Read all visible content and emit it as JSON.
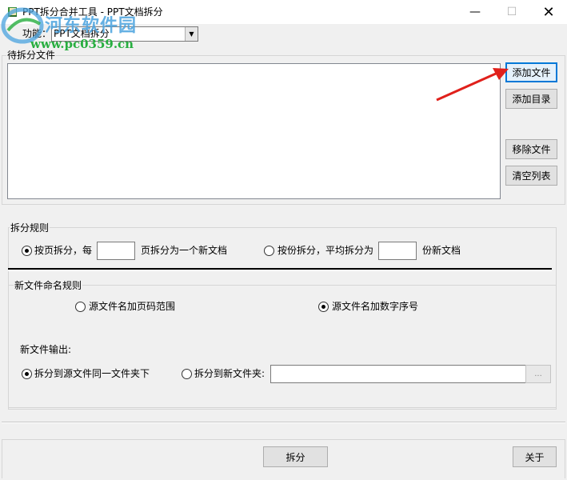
{
  "window": {
    "title": "PPT拆分合并工具 - PPT文档拆分",
    "minimize_glyph": "—",
    "maximize_glyph": "☐",
    "close_glyph": "✕",
    "app_icon": "book-icon"
  },
  "watermark": {
    "site_name": "河东软件园",
    "url": "www.pc0359.cn"
  },
  "function_row": {
    "label": "功能：",
    "selected": "PPT文档拆分"
  },
  "files": {
    "group_title": "待拆分文件",
    "buttons": {
      "add_file": "添加文件",
      "add_dir": "添加目录",
      "remove_file": "移除文件",
      "clear_list": "清空列表"
    }
  },
  "rules": {
    "group_title": "拆分规则",
    "by_page": {
      "label_pre": "按页拆分，每",
      "value": "",
      "label_post": "页拆分为一个新文档",
      "selected": true
    },
    "by_copies": {
      "label_pre": "按份拆分，平均拆分为",
      "value": "",
      "label_post": "份新文档",
      "selected": false
    },
    "naming": {
      "group_title": "新文件命名规则",
      "page_range": {
        "label": "源文件名加页码范围",
        "selected": false
      },
      "number_seq": {
        "label": "源文件名加数字序号",
        "selected": true
      }
    },
    "output": {
      "label": "新文件输出:",
      "same_folder": {
        "label": "拆分到源文件同一文件夹下",
        "selected": true
      },
      "new_folder": {
        "label": "拆分到新文件夹:",
        "selected": false
      },
      "path": "",
      "browse_label": "..."
    }
  },
  "bottom": {
    "split_label": "拆分",
    "about_label": "关于"
  },
  "colors": {
    "accent": "#0078d7",
    "arrow": "#e0201b",
    "watermark_blue": "#4aa3df",
    "watermark_green": "#27ae3f"
  }
}
